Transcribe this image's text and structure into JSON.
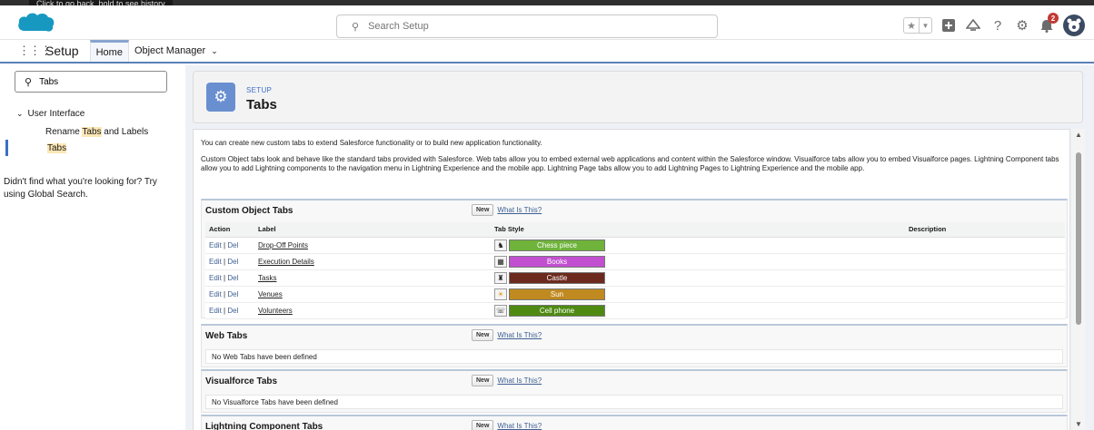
{
  "tooltip": "Click to go back, hold to see history",
  "header": {
    "search_placeholder": "Search Setup",
    "notification_count": "2"
  },
  "context_nav": {
    "app_name": "Setup",
    "tabs": [
      {
        "label": "Home"
      },
      {
        "label": "Object Manager"
      }
    ]
  },
  "sidebar": {
    "quickfind_value": "Tabs",
    "tree_root": "User Interface",
    "items": [
      {
        "prefix": "Rename ",
        "highlight": "Tabs",
        "suffix": " and Labels"
      },
      {
        "highlight": "Tabs"
      }
    ],
    "help_text": "Didn't find what you're looking for? Try using Global Search."
  },
  "page_header": {
    "eyebrow": "SETUP",
    "title": "Tabs"
  },
  "intro": {
    "line1": "You can create new custom tabs to extend Salesforce functionality or to build new application functionality.",
    "line2": "Custom Object tabs look and behave like the standard tabs provided with Salesforce. Web tabs allow you to embed external web applications and content within the Salesforce window. Visualforce tabs allow you to embed Visualforce pages. Lightning Component tabs allow you to add Lightning components to the navigation menu in Lightning Experience and the mobile app. Lightning Page tabs allow you to add Lightning Pages to Lightning Experience and the mobile app."
  },
  "buttons": {
    "new": "New",
    "what": "What Is This?"
  },
  "custom_object_tabs": {
    "title": "Custom Object Tabs",
    "columns": {
      "action": "Action",
      "label": "Label",
      "tab_style": "Tab Style",
      "description": "Description"
    },
    "rows": [
      {
        "edit": "Edit",
        "del": "Del",
        "label": "Drop-Off Points",
        "style_name": "Chess piece",
        "color": "#6fb33b",
        "icon": "chess-piece-icon"
      },
      {
        "edit": "Edit",
        "del": "Del",
        "label": "Execution Details",
        "style_name": "Books",
        "color": "#c14fd0",
        "icon": "books-icon"
      },
      {
        "edit": "Edit",
        "del": "Del",
        "label": "Tasks",
        "style_name": "Castle",
        "color": "#6b2a1d",
        "icon": "castle-icon"
      },
      {
        "edit": "Edit",
        "del": "Del",
        "label": "Venues",
        "style_name": "Sun",
        "color": "#c08a20",
        "icon": "sun-icon"
      },
      {
        "edit": "Edit",
        "del": "Del",
        "label": "Volunteers",
        "style_name": "Cell phone",
        "color": "#4e8a12",
        "icon": "cell-phone-icon"
      }
    ]
  },
  "web_tabs": {
    "title": "Web Tabs",
    "empty": "No Web Tabs have been defined"
  },
  "visualforce_tabs": {
    "title": "Visualforce Tabs",
    "empty": "No Visualforce Tabs have been defined"
  },
  "lightning_component_tabs": {
    "title": "Lightning Component Tabs"
  }
}
